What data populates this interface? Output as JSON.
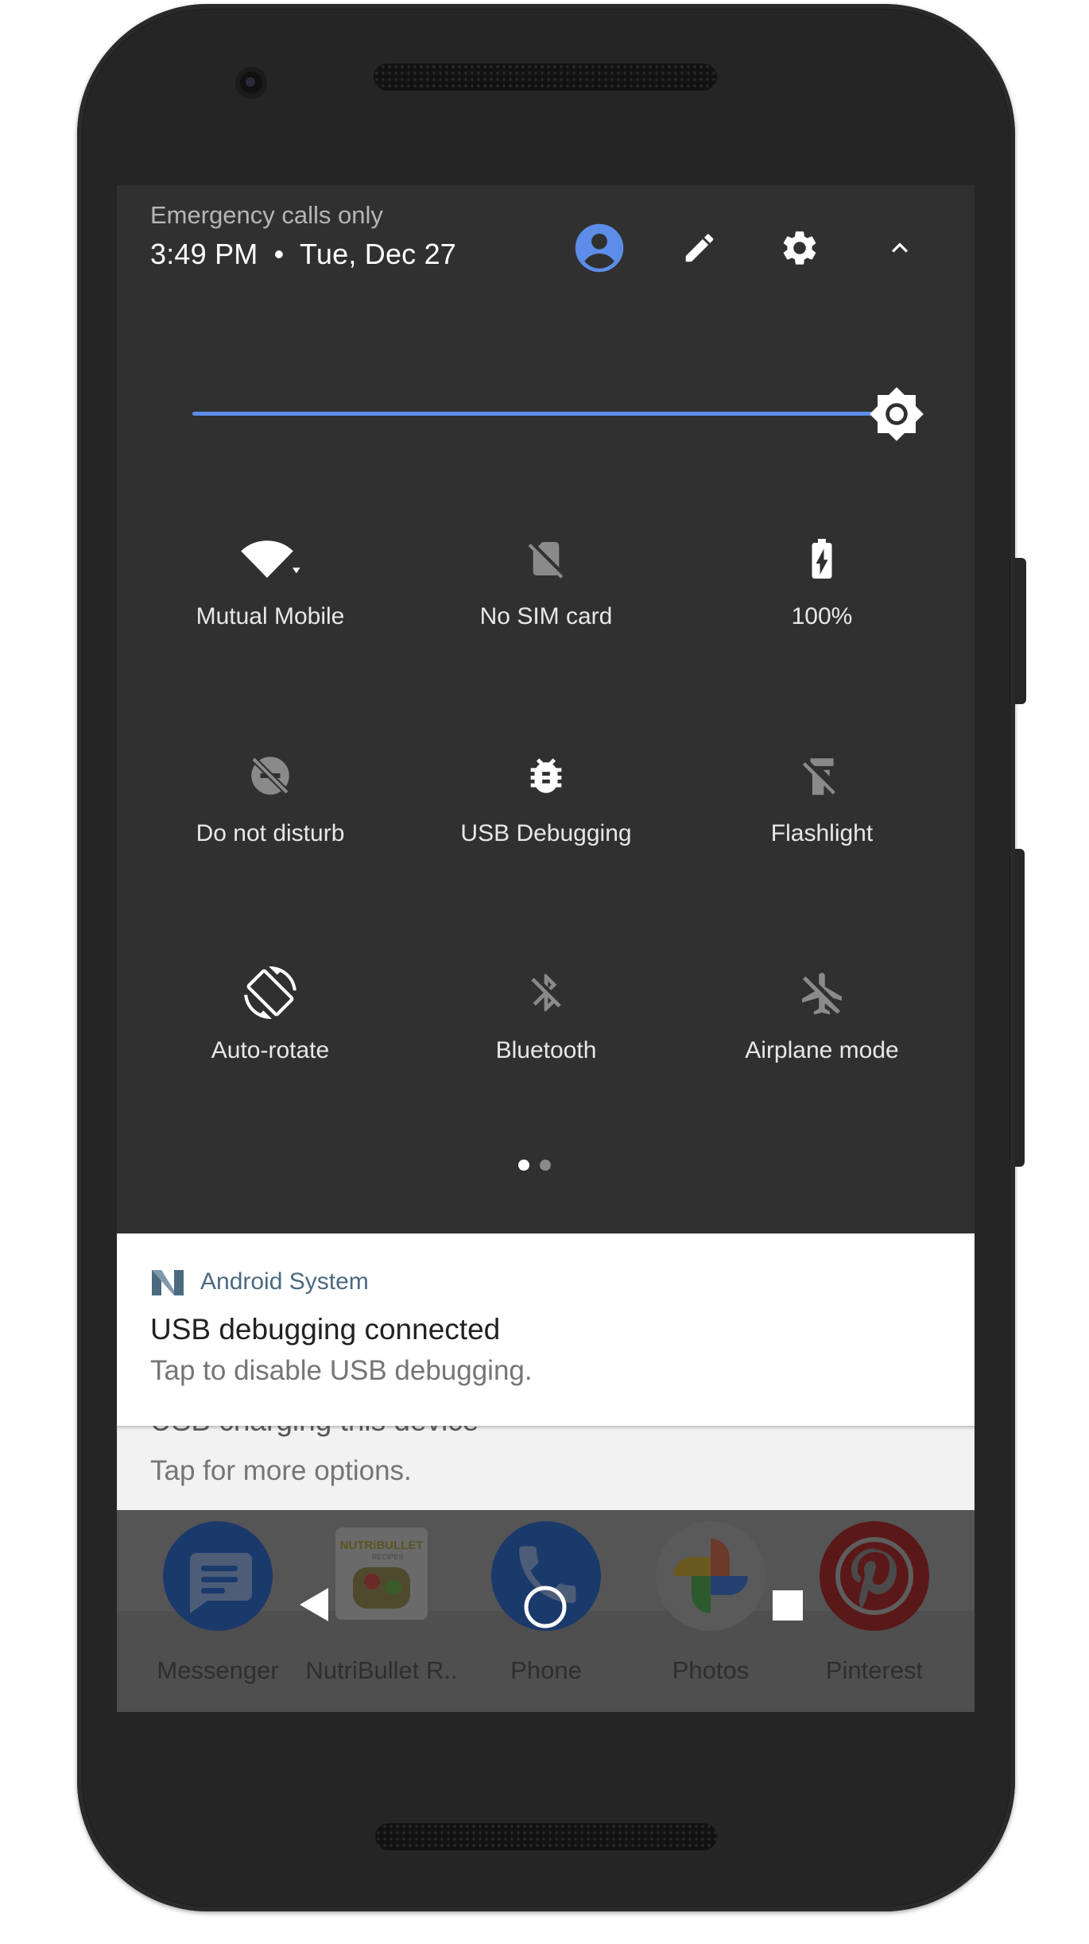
{
  "status": {
    "carrier": "Emergency calls only",
    "time": "3:49 PM",
    "separator": "•",
    "date": "Tue, Dec 27"
  },
  "header_icons": [
    "account-circle-icon",
    "edit-icon",
    "settings-icon",
    "collapse-chevron-icon"
  ],
  "colors": {
    "accent": "#5d8de8",
    "panel": "#303030",
    "tile_active": "#ffffff",
    "tile_inactive": "#8a8a8a"
  },
  "brightness": {
    "level": 1.0
  },
  "tiles": [
    {
      "label": "Mutual Mobile",
      "icon": "wifi-icon",
      "active": true
    },
    {
      "label": "No SIM card",
      "icon": "no-sim-icon",
      "active": false
    },
    {
      "label": "100%",
      "icon": "battery-charging-icon",
      "active": true
    },
    {
      "label": "Do not disturb",
      "icon": "do-not-disturb-icon",
      "active": false
    },
    {
      "label": "USB Debugging",
      "icon": "bug-icon",
      "active": true
    },
    {
      "label": "Flashlight",
      "icon": "flashlight-off-icon",
      "active": false
    },
    {
      "label": "Auto-rotate",
      "icon": "auto-rotate-icon",
      "active": true
    },
    {
      "label": "Bluetooth",
      "icon": "bluetooth-off-icon",
      "active": false
    },
    {
      "label": "Airplane mode",
      "icon": "airplane-mode-off-icon",
      "active": false
    }
  ],
  "pager": {
    "pages": 2,
    "current": 1
  },
  "notifications": [
    {
      "app": "Android System",
      "title": "USB debugging connected",
      "text": "Tap to disable USB debugging."
    },
    {
      "title": "USB charging this device",
      "text": "Tap for more options."
    }
  ],
  "launcher": {
    "apps": [
      {
        "label": "Messenger",
        "icon": "messenger-icon"
      },
      {
        "label": "NutriBullet R..",
        "icon": "nutribullet-icon"
      },
      {
        "label": "Phone",
        "icon": "phone-icon"
      },
      {
        "label": "Photos",
        "icon": "photos-icon"
      },
      {
        "label": "Pinterest",
        "icon": "pinterest-icon"
      }
    ],
    "nutribullet_brand": "NUTRiBULLET",
    "nutribullet_sub": "RECIPES"
  },
  "navbar": [
    "back-icon",
    "home-icon",
    "recents-icon"
  ]
}
